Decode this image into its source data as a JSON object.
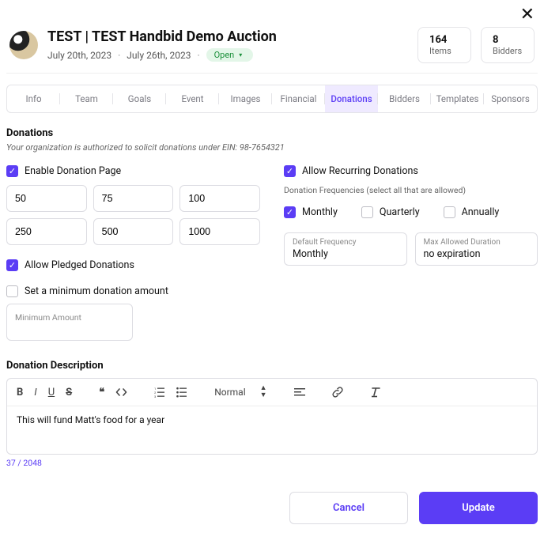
{
  "header": {
    "title": "TEST | TEST Handbid Demo Auction",
    "date_start": "July 20th, 2023",
    "date_end": "July 26th, 2023",
    "status": "Open",
    "stats": {
      "items_count": "164",
      "items_label": "Items",
      "bidders_count": "8",
      "bidders_label": "Bidders"
    }
  },
  "tabs": [
    "Info",
    "Team",
    "Goals",
    "Event",
    "Images",
    "Financial",
    "Donations",
    "Bidders",
    "Templates",
    "Sponsors"
  ],
  "donations": {
    "title": "Donations",
    "hint": "Your organization is authorized to solicit donations under EIN: 98-7654321",
    "enable_label": "Enable Donation Page",
    "amounts": [
      "50",
      "75",
      "100",
      "250",
      "500",
      "1000"
    ],
    "pledged_label": "Allow Pledged Donations",
    "min_label": "Set a minimum donation amount",
    "min_placeholder": "Minimum Amount",
    "recurring_label": "Allow Recurring Donations",
    "freq_hint": "Donation Frequencies (select all that are allowed)",
    "freq_monthly": "Monthly",
    "freq_quarterly": "Quarterly",
    "freq_annually": "Annually",
    "default_freq_label": "Default Frequency",
    "default_freq_value": "Monthly",
    "max_dur_label": "Max Allowed Duration",
    "max_dur_value": "no expiration"
  },
  "description": {
    "title": "Donation Description",
    "normal_label": "Normal",
    "body": "This will fund Matt's food for a year",
    "counter": "37 / 2048"
  },
  "footer": {
    "cancel": "Cancel",
    "update": "Update"
  }
}
